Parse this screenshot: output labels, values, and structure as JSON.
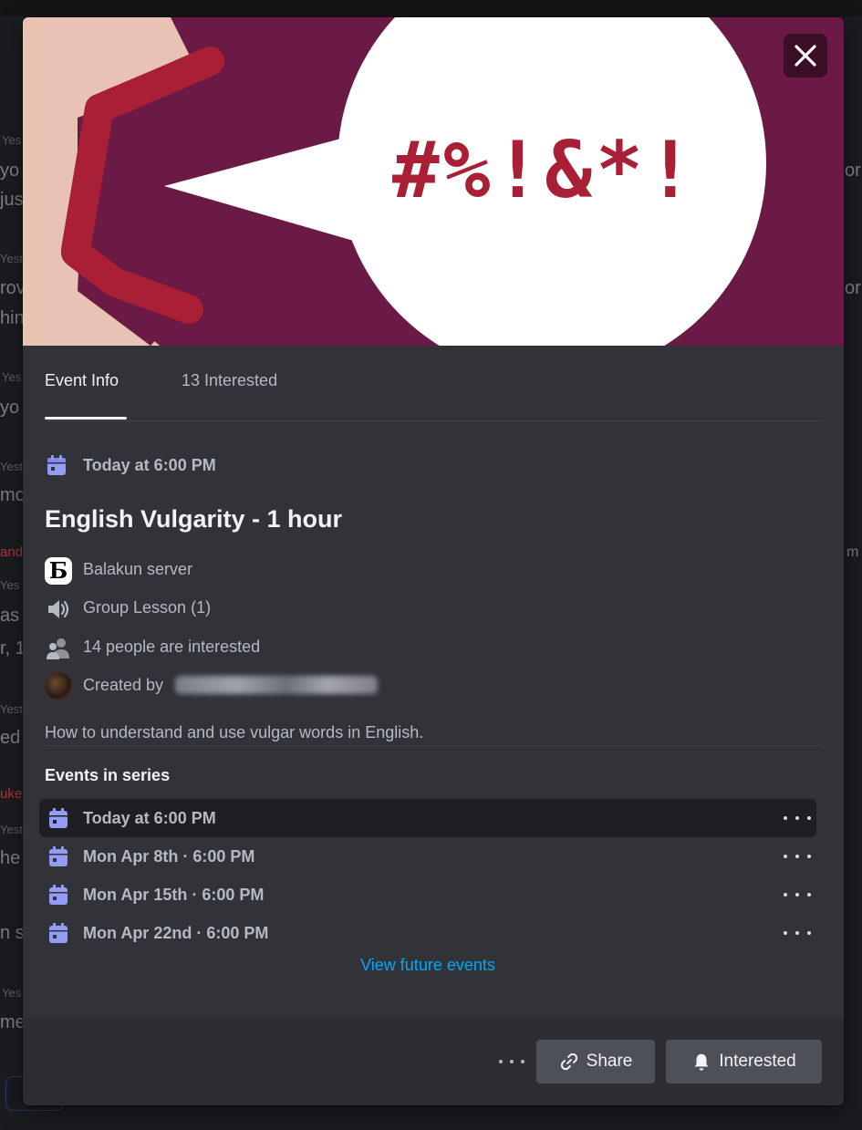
{
  "background": {
    "fragments": [
      "Yes",
      "yo",
      "jus",
      "Yest",
      "rov",
      "hin",
      "Yes",
      "yo",
      "Yest",
      "mo",
      "and",
      "Yes",
      "as",
      "r, 1",
      "Yest",
      "ed",
      "uke",
      "Yest",
      "he",
      "n s",
      "Yes",
      "me",
      "or",
      "or",
      "m"
    ]
  },
  "banner": {
    "speech_text": "#%!&*!",
    "colors": {
      "background": "#6b1a45",
      "skin": "#e9c3b2",
      "lips": "#a91f35",
      "bubble": "#ffffff"
    }
  },
  "close_button": {
    "icon": "close-icon"
  },
  "tabs": [
    {
      "label": "Event Info",
      "active": true
    },
    {
      "label": "13 Interested",
      "active": false
    }
  ],
  "event": {
    "date": "Today at 6:00 PM",
    "title": "English Vulgarity - 1 hour",
    "server": "Balakun server",
    "server_logo_letter": "Ƃ",
    "channel": "Group Lesson (1)",
    "interested_count": "14 people are interested",
    "created_by_label": "Created by",
    "description": "How to understand and use vulgar words in English."
  },
  "series": {
    "heading": "Events in series",
    "items": [
      {
        "label": "Today at 6:00 PM",
        "highlighted": true
      },
      {
        "label": "Mon Apr 8th · 6:00 PM",
        "highlighted": false
      },
      {
        "label": "Mon Apr 15th · 6:00 PM",
        "highlighted": false
      },
      {
        "label": "Mon Apr 22nd · 6:00 PM",
        "highlighted": false
      }
    ],
    "view_future": "View future events"
  },
  "footer": {
    "share_label": "Share",
    "interested_label": "Interested"
  },
  "colors": {
    "accent_calendar": "#949cf7",
    "link": "#00a8fc",
    "modal_bg": "#313338",
    "footer_bg": "#2b2d31",
    "button_bg": "#4e5058"
  }
}
